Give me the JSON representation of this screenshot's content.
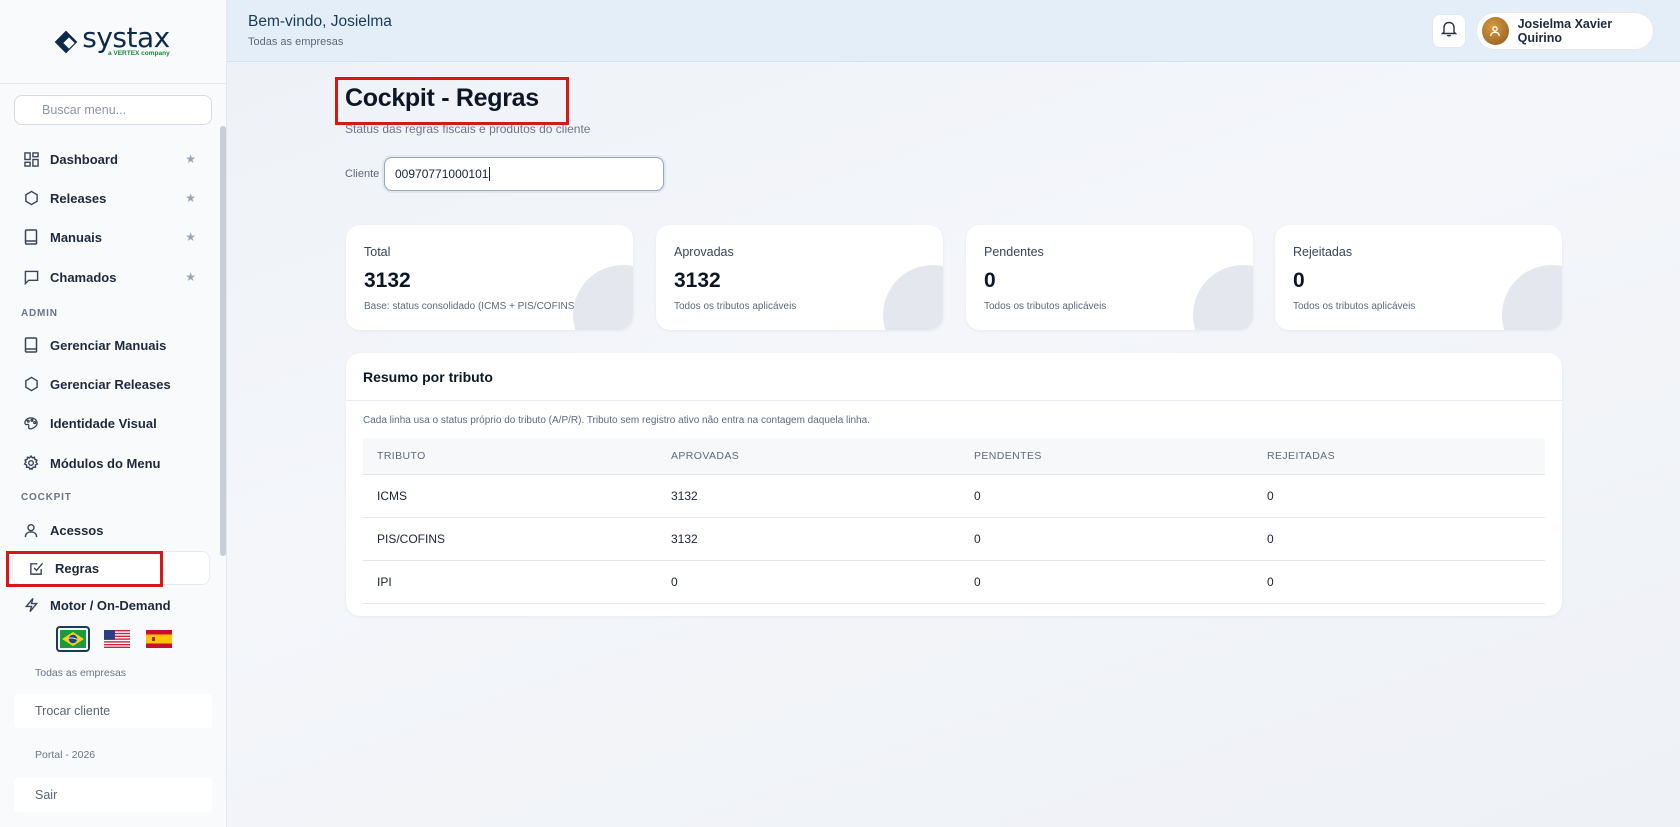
{
  "brand": {
    "name": "systax",
    "tagline": "a VERTEX company"
  },
  "sidebar": {
    "search_placeholder": "Buscar menu...",
    "items": [
      {
        "label": "Dashboard",
        "icon": "grid-icon",
        "starred": true
      },
      {
        "label": "Releases",
        "icon": "hexagon-icon",
        "starred": true
      },
      {
        "label": "Manuais",
        "icon": "book-icon",
        "starred": true
      },
      {
        "label": "Chamados",
        "icon": "chat-icon",
        "starred": true
      }
    ],
    "admin_label": "ADMIN",
    "admin_items": [
      {
        "label": "Gerenciar Manuais",
        "icon": "book-icon"
      },
      {
        "label": "Gerenciar Releases",
        "icon": "hexagon-icon"
      },
      {
        "label": "Identidade Visual",
        "icon": "palette-icon"
      },
      {
        "label": "Módulos do Menu",
        "icon": "gear-icon"
      }
    ],
    "cockpit_label": "COCKPIT",
    "cockpit_items": [
      {
        "label": "Acessos",
        "icon": "user-icon"
      },
      {
        "label": "Regras",
        "icon": "checkbox-icon",
        "active": true
      },
      {
        "label": "Motor / On-Demand",
        "icon": "bolt-icon"
      }
    ],
    "languages": [
      "pt-BR",
      "en-US",
      "es-ES"
    ],
    "selected_language": "pt-BR",
    "company_scope": "Todas as empresas",
    "switch_client": "Trocar cliente",
    "portal_version": "Portal - 2026",
    "logout": "Sair"
  },
  "header": {
    "welcome": "Bem-vindo, Josielma",
    "scope": "Todas as empresas",
    "user_name": "Josielma Xavier Quirino"
  },
  "page": {
    "title": "Cockpit - Regras",
    "subtitle": "Status das regras fiscais e produtos do cliente",
    "client_label": "Cliente",
    "client_value": "00970771000101"
  },
  "stats": [
    {
      "label": "Total",
      "value": "3132",
      "desc": "Base: status consolidado (ICMS + PIS/COFINS + IPI)"
    },
    {
      "label": "Aprovadas",
      "value": "3132",
      "desc": "Todos os tributos aplicáveis"
    },
    {
      "label": "Pendentes",
      "value": "0",
      "desc": "Todos os tributos aplicáveis"
    },
    {
      "label": "Rejeitadas",
      "value": "0",
      "desc": "Todos os tributos aplicáveis"
    }
  ],
  "summary": {
    "title": "Resumo por tributo",
    "note": "Cada linha usa o status próprio do tributo (A/P/R). Tributo sem registro ativo não entra na contagem daquela linha.",
    "headers": [
      "TRIBUTO",
      "APROVADAS",
      "PENDENTES",
      "REJEITADAS"
    ],
    "rows": [
      [
        "ICMS",
        "3132",
        "0",
        "0"
      ],
      [
        "PIS/COFINS",
        "3132",
        "0",
        "0"
      ],
      [
        "IPI",
        "0",
        "0",
        "0"
      ]
    ]
  },
  "colors": {
    "highlight": "#d81818",
    "header_bg": "#e4eef8",
    "brand_navy": "#0e2a4a",
    "brand_green": "#178a3c"
  }
}
